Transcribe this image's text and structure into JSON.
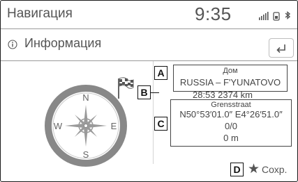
{
  "header": {
    "app_title": "Навигация",
    "clock": "9:35",
    "status_icons": [
      "signal-bars-icon",
      "battery-phone-icon",
      "bluetooth-icon"
    ]
  },
  "subheader": {
    "icon": "info-icon",
    "title": "Информация",
    "back_icon": "back-arrow-icon"
  },
  "compass": {
    "north": "N",
    "south": "S",
    "east": "E",
    "west": "W"
  },
  "destination": {
    "name": "Дом",
    "address": "RUSSIA – F'YUNATOVO",
    "time_distance": "28:53 2374 km"
  },
  "location": {
    "street": "Grensstraat",
    "coordinates": "N50°53′01.0″ E4°26′51.0″",
    "value": "0/0",
    "altitude": "0 m"
  },
  "callouts": {
    "a": "A",
    "b": "B",
    "c": "C",
    "d": "D"
  },
  "save": {
    "icon": "star-icon",
    "label": "Сохр."
  },
  "colors": {
    "text": "#555555",
    "border": "#444444"
  }
}
